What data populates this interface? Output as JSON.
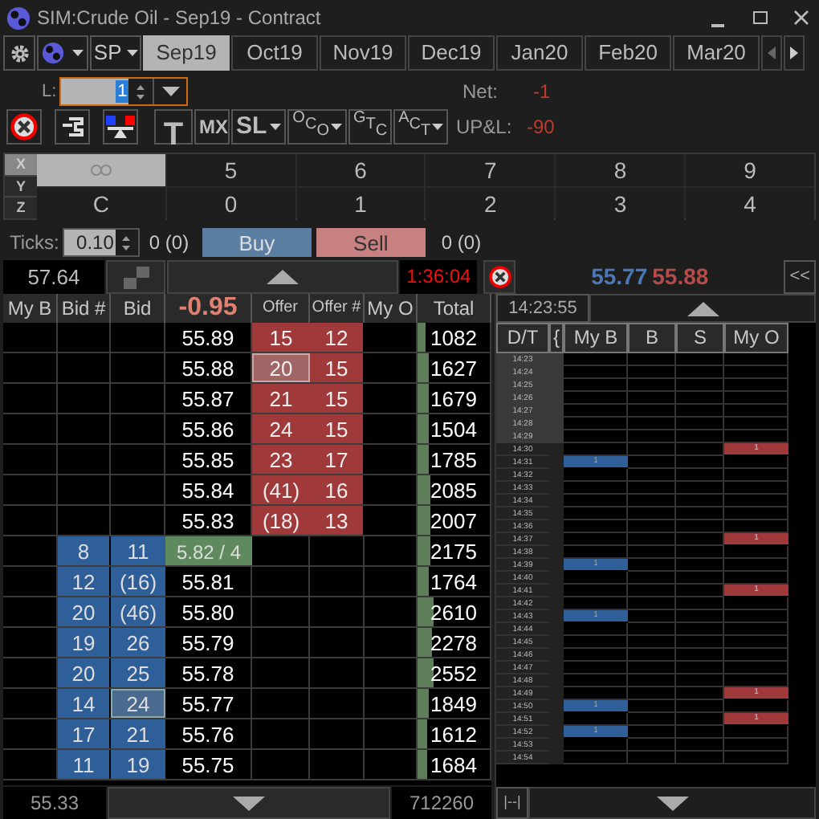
{
  "window": {
    "title": "SIM:Crude Oil - Sep19 - Contract"
  },
  "toolbar": {
    "account": "SP"
  },
  "tabs": [
    {
      "label": "Sep19",
      "selected": true
    },
    {
      "label": "Oct19",
      "selected": false
    },
    {
      "label": "Nov19",
      "selected": false
    },
    {
      "label": "Dec19",
      "selected": false
    },
    {
      "label": "Jan20",
      "selected": false
    },
    {
      "label": "Feb20",
      "selected": false
    },
    {
      "label": "Mar20",
      "selected": false
    }
  ],
  "quantity": {
    "label": "L:",
    "value": "1"
  },
  "position": {
    "net_label": "Net:",
    "net": "-1",
    "upl_label": "UP&L:",
    "upl": "-90"
  },
  "order_buttons": [
    {
      "kind": "plain",
      "label": "T"
    },
    {
      "kind": "plain",
      "label": "MX"
    },
    {
      "kind": "dropdown",
      "label": "SL"
    },
    {
      "kind": "stair",
      "label": "OCO",
      "dropdown": true
    },
    {
      "kind": "stair",
      "label": "GTC",
      "dropdown": false
    },
    {
      "kind": "stair",
      "label": "ACT",
      "dropdown": true
    }
  ],
  "hotkeys": {
    "row_labels": [
      "X",
      "Y",
      "Z"
    ],
    "row_1": [
      {
        "kind": "link",
        "selected": true
      },
      {
        "kind": "key",
        "label": "5",
        "selected": false
      },
      {
        "kind": "key",
        "label": "6",
        "selected": false
      },
      {
        "kind": "key",
        "label": "7",
        "selected": false
      },
      {
        "kind": "key",
        "label": "8",
        "selected": false
      },
      {
        "kind": "key",
        "label": "9",
        "selected": false
      }
    ],
    "row_2": [
      "C",
      "0",
      "1",
      "2",
      "3",
      "4"
    ]
  },
  "ticks": {
    "label": "Ticks:",
    "value": "0.10",
    "buy_fill": "0 (0)",
    "buy": "Buy",
    "sell": "Sell",
    "sell_fill": "0 (0)"
  },
  "info": {
    "last": "57.64",
    "timer": "1:36:04",
    "bid": "55.77",
    "ask": "55.88",
    "collapse": "<<"
  },
  "ladder": {
    "columns": [
      "My B",
      "Bid #",
      "Bid",
      "-0.95",
      "Offer",
      "Offer #",
      "My O",
      "Total"
    ],
    "rows": [
      {
        "price": "55.89",
        "offer": "15",
        "offer_count": "12",
        "total": "1082",
        "level": 0.12,
        "highlighted": false,
        "kind": "price"
      },
      {
        "price": "55.88",
        "offer": "20",
        "offer_count": "15",
        "total": "1627",
        "level": 0.15,
        "highlighted": true,
        "kind": "price"
      },
      {
        "price": "55.87",
        "offer": "21",
        "offer_count": "15",
        "total": "1679",
        "level": 0.15,
        "highlighted": false,
        "kind": "price"
      },
      {
        "price": "55.86",
        "offer": "24",
        "offer_count": "15",
        "total": "1504",
        "level": 0.15,
        "highlighted": false,
        "kind": "price"
      },
      {
        "price": "55.85",
        "offer": "23",
        "offer_count": "17",
        "total": "1785",
        "level": 0.16,
        "highlighted": false,
        "kind": "price"
      },
      {
        "price": "55.84",
        "offer": "(41)",
        "offer_count": "16",
        "total": "2085",
        "level": 0.17,
        "highlighted": false,
        "kind": "price"
      },
      {
        "price": "55.83",
        "offer": "(18)",
        "offer_count": "13",
        "total": "2007",
        "level": 0.17,
        "highlighted": false,
        "kind": "price"
      },
      {
        "price": "5.82 / 4",
        "bid_count": "8",
        "bid": "11",
        "total": "2175",
        "level": 0.18,
        "highlighted": false,
        "kind": "last"
      },
      {
        "price": "55.81",
        "bid_count": "12",
        "bid": "(16)",
        "total": "1764",
        "level": 0.15,
        "highlighted": false,
        "kind": "price"
      },
      {
        "price": "55.80",
        "bid_count": "20",
        "bid": "(46)",
        "total": "2610",
        "level": 0.22,
        "highlighted": false,
        "kind": "price"
      },
      {
        "price": "55.79",
        "bid_count": "19",
        "bid": "26",
        "total": "2278",
        "level": 0.19,
        "highlighted": false,
        "kind": "price"
      },
      {
        "price": "55.78",
        "bid_count": "20",
        "bid": "25",
        "total": "2552",
        "level": 0.22,
        "highlighted": false,
        "kind": "price"
      },
      {
        "price": "55.77",
        "bid_count": "14",
        "bid": "24",
        "total": "1849",
        "level": 0.16,
        "highlighted": true,
        "kind": "price"
      },
      {
        "price": "55.76",
        "bid_count": "17",
        "bid": "21",
        "total": "1612",
        "level": 0.14,
        "highlighted": false,
        "kind": "price"
      },
      {
        "price": "55.75",
        "bid_count": "11",
        "bid": "19",
        "total": "1684",
        "level": 0.14,
        "highlighted": false,
        "kind": "price"
      }
    ],
    "footer_low": "55.33",
    "footer_volume": "712260"
  },
  "time_panel": {
    "clock": "14:23:55",
    "columns": [
      "D/T",
      "{",
      "My B",
      "B",
      "S",
      "My O"
    ],
    "footer": "|--|",
    "rows": [
      {
        "time": "14:23",
        "history": true
      },
      {
        "time": "14:24",
        "history": true
      },
      {
        "time": "14:25",
        "history": true
      },
      {
        "time": "14:26",
        "history": true
      },
      {
        "time": "14:27",
        "history": true
      },
      {
        "time": "14:28",
        "history": true
      },
      {
        "time": "14:29",
        "history": true
      },
      {
        "time": "14:30",
        "history": false,
        "my_offer": "1"
      },
      {
        "time": "14:31",
        "history": false,
        "my_bid": "1"
      },
      {
        "time": "14:32",
        "history": false
      },
      {
        "time": "14:33",
        "history": false
      },
      {
        "time": "14:34",
        "history": false
      },
      {
        "time": "14:35",
        "history": false
      },
      {
        "time": "14:36",
        "history": false
      },
      {
        "time": "14:37",
        "history": false,
        "my_offer": "1"
      },
      {
        "time": "14:38",
        "history": false
      },
      {
        "time": "14:39",
        "history": false,
        "my_bid": "1"
      },
      {
        "time": "14:40",
        "history": false
      },
      {
        "time": "14:41",
        "history": false,
        "my_offer": "1"
      },
      {
        "time": "14:42",
        "history": false
      },
      {
        "time": "14:43",
        "history": false,
        "my_bid": "1"
      },
      {
        "time": "14:44",
        "history": false
      },
      {
        "time": "14:45",
        "history": false
      },
      {
        "time": "14:46",
        "history": false
      },
      {
        "time": "14:47",
        "history": false
      },
      {
        "time": "14:48",
        "history": false
      },
      {
        "time": "14:49",
        "history": false,
        "my_offer": "1"
      },
      {
        "time": "14:50",
        "history": false,
        "my_bid": "1"
      },
      {
        "time": "14:51",
        "history": false,
        "my_offer": "1"
      },
      {
        "time": "14:52",
        "history": false,
        "my_bid": "1"
      },
      {
        "time": "14:53",
        "history": false
      },
      {
        "time": "14:54",
        "history": false
      }
    ]
  }
}
